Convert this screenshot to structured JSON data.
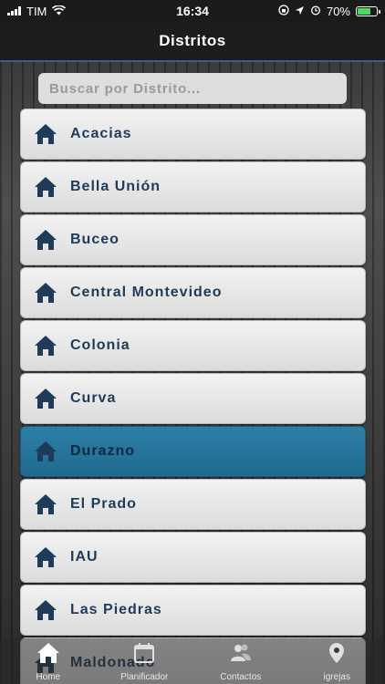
{
  "status_bar": {
    "carrier": "TIM",
    "time": "16:34",
    "battery": "70%",
    "battery_level": 0.7
  },
  "nav": {
    "title": "Distritos"
  },
  "search": {
    "placeholder": "Buscar por Distrito..."
  },
  "districts": [
    {
      "label": "Acacias"
    },
    {
      "label": "Bella Unión"
    },
    {
      "label": "Buceo"
    },
    {
      "label": "Central Montevideo"
    },
    {
      "label": "Colonia"
    },
    {
      "label": "Curva"
    },
    {
      "label": "Durazno",
      "selected": true
    },
    {
      "label": "El Prado"
    },
    {
      "label": "IAU"
    },
    {
      "label": "Las Piedras"
    },
    {
      "label": "Maldonado"
    }
  ],
  "tabs": [
    {
      "label": "Home",
      "icon": "home-icon"
    },
    {
      "label": "Planificador",
      "icon": "calendar-icon"
    },
    {
      "label": "Contactos",
      "icon": "contacts-icon"
    },
    {
      "label": "igrejas",
      "icon": "location-pin-icon"
    }
  ],
  "colors": {
    "accent": "#1f6a90",
    "icon": "#1e3b5a"
  }
}
